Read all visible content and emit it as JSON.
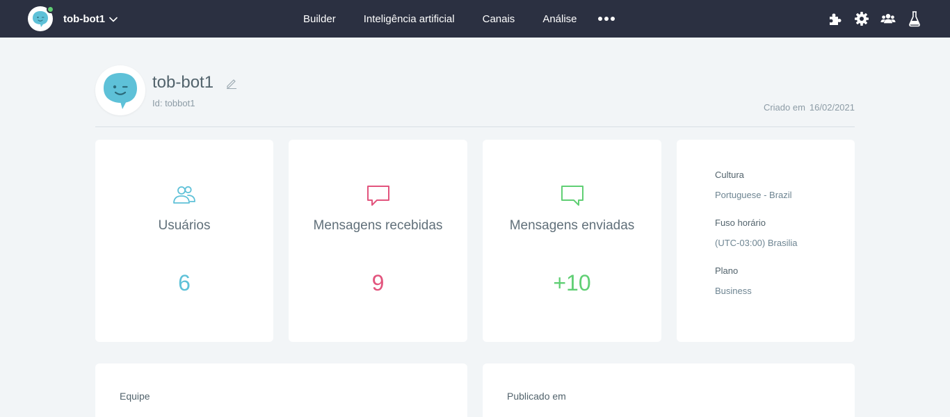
{
  "topbar": {
    "bot_name": "tob-bot1",
    "nav": [
      {
        "label": "Builder",
        "icon": null
      },
      {
        "label": "Inteligência artificial",
        "icon": null
      },
      {
        "label": "Canais",
        "icon": null
      },
      {
        "label": "Análise",
        "icon": null
      }
    ],
    "more_icon": "more-dots-icon",
    "icons": [
      "puzzle-icon",
      "gear-icon",
      "team-icon",
      "flask-icon"
    ],
    "status_color": "#60cf74",
    "background": "#2b3041"
  },
  "header": {
    "title": "tob-bot1",
    "id_text": "Id: tobbot1",
    "created_label": "Criado em",
    "created_date": "16/02/2021"
  },
  "stats": [
    {
      "label": "Usuários",
      "value": "6",
      "icon": "users-icon",
      "color": "#5ec1d8"
    },
    {
      "label": "Mensagens recebidas",
      "value": "9",
      "icon": "chat-received-icon",
      "color": "#e2547d"
    },
    {
      "label": "Mensagens enviadas",
      "value": "+10",
      "icon": "chat-sent-icon",
      "color": "#60cf74"
    }
  ],
  "info": {
    "culture_label": "Cultura",
    "culture_value": "Portuguese - Brazil",
    "timezone_label": "Fuso horário",
    "timezone_value": "(UTC-03:00) Brasilia",
    "plan_label": "Plano",
    "plan_value": "Business"
  },
  "bottom": {
    "team_title": "Equipe",
    "published_title": "Publicado em"
  }
}
